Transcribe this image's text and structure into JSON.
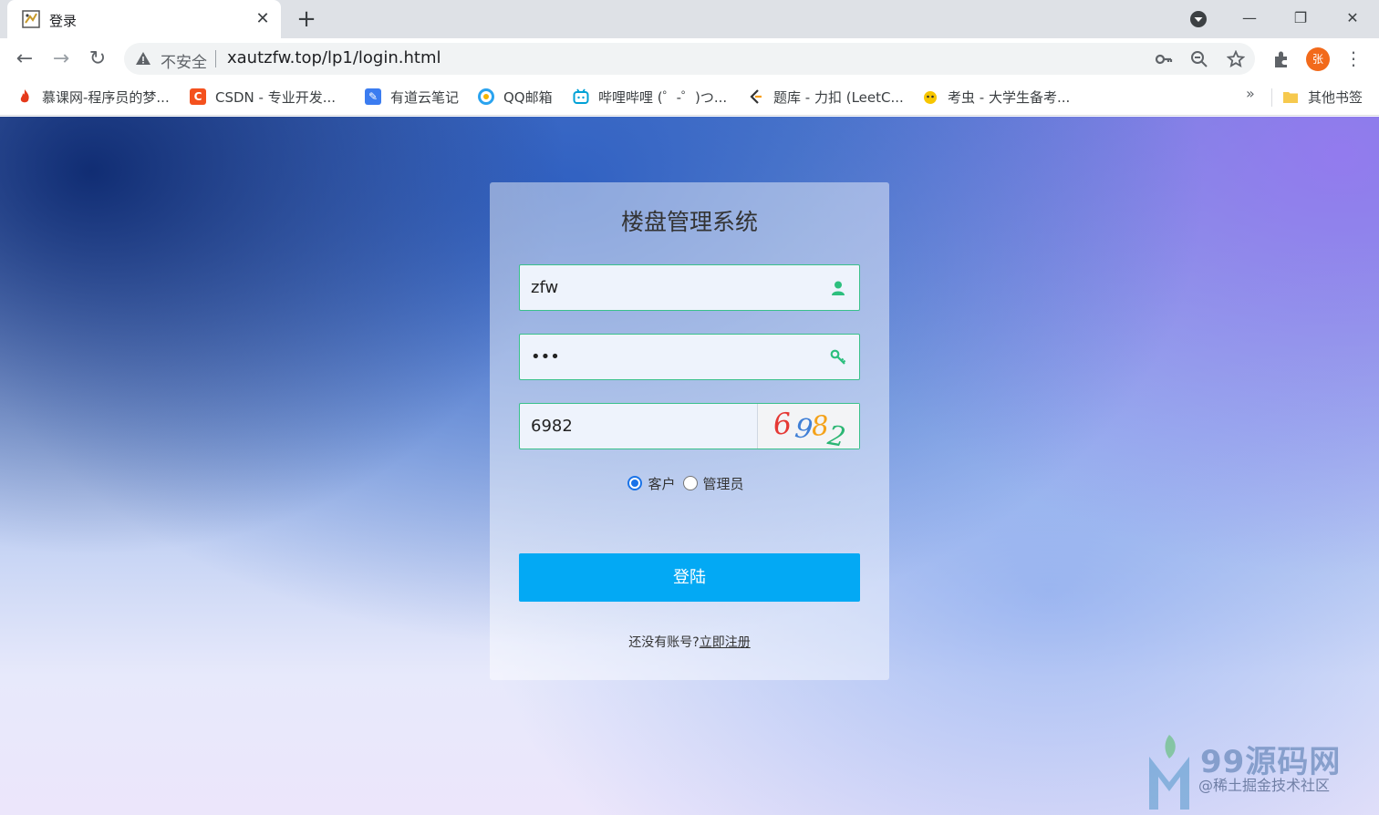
{
  "tab": {
    "title": "登录",
    "close": "✕",
    "new_tab": "+"
  },
  "window": {
    "minimize": "—",
    "restore": "❐",
    "close": "✕"
  },
  "toolbar": {
    "back": "←",
    "forward": "→",
    "reload": "↻",
    "insecure_label": "不安全",
    "url": "xautzfw.top/lp1/login.html",
    "avatar_initial": "张",
    "menu": "⋮"
  },
  "bookmarks": {
    "items": [
      {
        "label": "慕课网-程序员的梦...",
        "icon": "flame-icon",
        "color": "#e5391a"
      },
      {
        "label": "CSDN - 专业开发...",
        "icon": "csdn-icon",
        "color": "#f4511e"
      },
      {
        "label": "有道云笔记",
        "icon": "note-icon",
        "color": "#3b7cf0"
      },
      {
        "label": "QQ邮箱",
        "icon": "mail-icon",
        "color": "#2aa3ef"
      },
      {
        "label": "哔哩哔哩 (゜-゜)つ...",
        "icon": "bilibili-icon",
        "color": "#00a1d6"
      },
      {
        "label": "题库 - 力扣 (LeetC...",
        "icon": "leetcode-icon",
        "color": "#f89f1b"
      },
      {
        "label": "考虫 - 大学生备考...",
        "icon": "kaochong-icon",
        "color": "#f7c600"
      }
    ],
    "more": "»",
    "other_folder": "其他书签"
  },
  "login": {
    "title": "楼盘管理系统",
    "username_value": "zfw",
    "password_value": "•••",
    "captcha_value": "6982",
    "captcha_digits": [
      "6",
      "9",
      "8",
      "2"
    ],
    "captcha_colors": [
      "#e53935",
      "#3f7fd6",
      "#f4a21a",
      "#2bb673"
    ],
    "roles": [
      {
        "label": "客户",
        "checked": true
      },
      {
        "label": "管理员",
        "checked": false
      }
    ],
    "submit_label": "登陆",
    "register_prompt": "还没有账号?",
    "register_link": "立即注册",
    "accent_color": "#03a9f4",
    "border_color": "#39c08b"
  },
  "watermark": {
    "text": "99源码网",
    "sub": "@稀土掘金技术社区"
  }
}
